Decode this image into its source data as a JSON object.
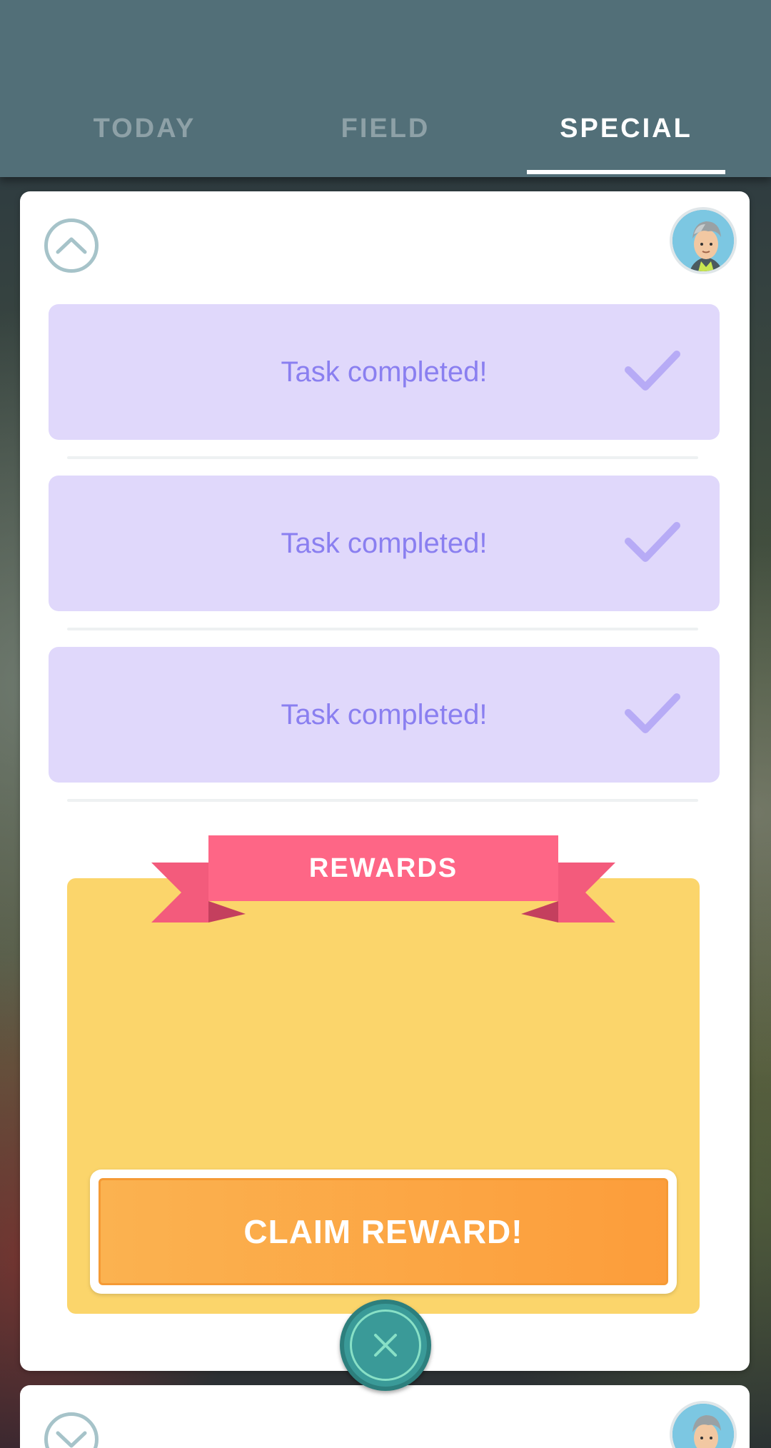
{
  "tabs": [
    {
      "label": "TODAY",
      "active": false
    },
    {
      "label": "FIELD",
      "active": false
    },
    {
      "label": "SPECIAL",
      "active": true
    }
  ],
  "card": {
    "collapse_icon": "chevron-up-icon",
    "avatar_icon": "professor-avatar-icon",
    "tasks": [
      {
        "text": "Task completed!",
        "status": "completed",
        "icon": "checkmark-icon"
      },
      {
        "text": "Task completed!",
        "status": "completed",
        "icon": "checkmark-icon"
      },
      {
        "text": "Task completed!",
        "status": "completed",
        "icon": "checkmark-icon"
      }
    ],
    "rewards": {
      "title": "REWARDS",
      "claim_label": "CLAIM REWARD!"
    },
    "close_icon": "close-icon"
  },
  "next_card": {
    "expand_icon": "chevron-down-icon",
    "avatar_icon": "professor-avatar-icon"
  },
  "colors": {
    "header": "#526f78",
    "task_bg": "#e0d8fb",
    "task_text": "#8a7ff0",
    "rewards_bg": "#fbd56b",
    "ribbon": "#fe6686",
    "claim_button": "#fc9d3b",
    "close_button": "#3a9a98"
  }
}
